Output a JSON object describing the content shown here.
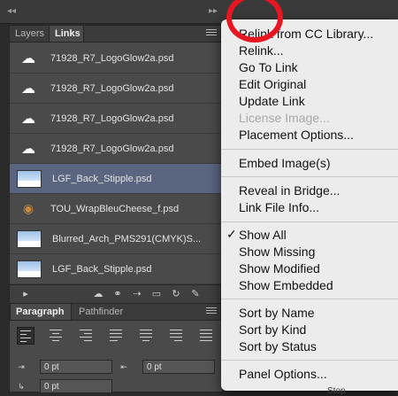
{
  "links_panel": {
    "tabs": [
      {
        "label": "Layers",
        "active": false
      },
      {
        "label": "Links",
        "active": true
      }
    ],
    "files": [
      {
        "name": "71928_R7_LogoGlow2a.psd",
        "thumb": "cloud-icon",
        "selected": false
      },
      {
        "name": "71928_R7_LogoGlow2a.psd",
        "thumb": "cloud-icon",
        "selected": false
      },
      {
        "name": "71928_R7_LogoGlow2a.psd",
        "thumb": "cloud-icon",
        "selected": false
      },
      {
        "name": "71928_R7_LogoGlow2a.psd",
        "thumb": "cloud-icon",
        "selected": false
      },
      {
        "name": "LGF_Back_Stipple.psd",
        "thumb": "sky-icon",
        "selected": true
      },
      {
        "name": "TOU_WrapBleuCheese_f.psd",
        "thumb": "cheese-icon",
        "selected": false
      },
      {
        "name": "Blurred_Arch_PMS291(CMYK)S...",
        "thumb": "sky-icon",
        "selected": false
      },
      {
        "name": "LGF_Back_Stipple.psd",
        "thumb": "sky-icon",
        "selected": false
      }
    ]
  },
  "paragraph_panel": {
    "tabs": [
      {
        "label": "Paragraph",
        "active": true
      },
      {
        "label": "Pathfinder",
        "active": false
      }
    ],
    "indent_left": "0 pt",
    "indent_right": "0 pt",
    "indent_first": "0 pt"
  },
  "context_menu": {
    "groups": [
      [
        {
          "label": "Relink from CC Library...",
          "disabled": false,
          "checked": false
        },
        {
          "label": "Relink...",
          "disabled": false,
          "checked": false
        },
        {
          "label": "Go To Link",
          "disabled": false,
          "checked": false
        },
        {
          "label": "Edit Original",
          "disabled": false,
          "checked": false
        },
        {
          "label": "Update Link",
          "disabled": false,
          "checked": false
        },
        {
          "label": "License Image...",
          "disabled": true,
          "checked": false
        },
        {
          "label": "Placement Options...",
          "disabled": false,
          "checked": false
        }
      ],
      [
        {
          "label": "Embed Image(s)",
          "disabled": false,
          "checked": false
        }
      ],
      [
        {
          "label": "Reveal in Bridge...",
          "disabled": false,
          "checked": false
        },
        {
          "label": "Link File Info...",
          "disabled": false,
          "checked": false
        }
      ],
      [
        {
          "label": "Show All",
          "disabled": false,
          "checked": true
        },
        {
          "label": "Show Missing",
          "disabled": false,
          "checked": false
        },
        {
          "label": "Show Modified",
          "disabled": false,
          "checked": false
        },
        {
          "label": "Show Embedded",
          "disabled": false,
          "checked": false
        }
      ],
      [
        {
          "label": "Sort by Name",
          "disabled": false,
          "checked": false
        },
        {
          "label": "Sort by Kind",
          "disabled": false,
          "checked": false
        },
        {
          "label": "Sort by Status",
          "disabled": false,
          "checked": false
        }
      ],
      [
        {
          "label": "Panel Options...",
          "disabled": false,
          "checked": false
        }
      ]
    ],
    "check_glyph": "✓"
  },
  "bottom_partial_label": "Stop",
  "colors": {
    "panel_bg": "#4a4a4a",
    "selection": "#5a6580",
    "menu_bg": "#ececec",
    "highlight_circle": "#e8161e"
  }
}
